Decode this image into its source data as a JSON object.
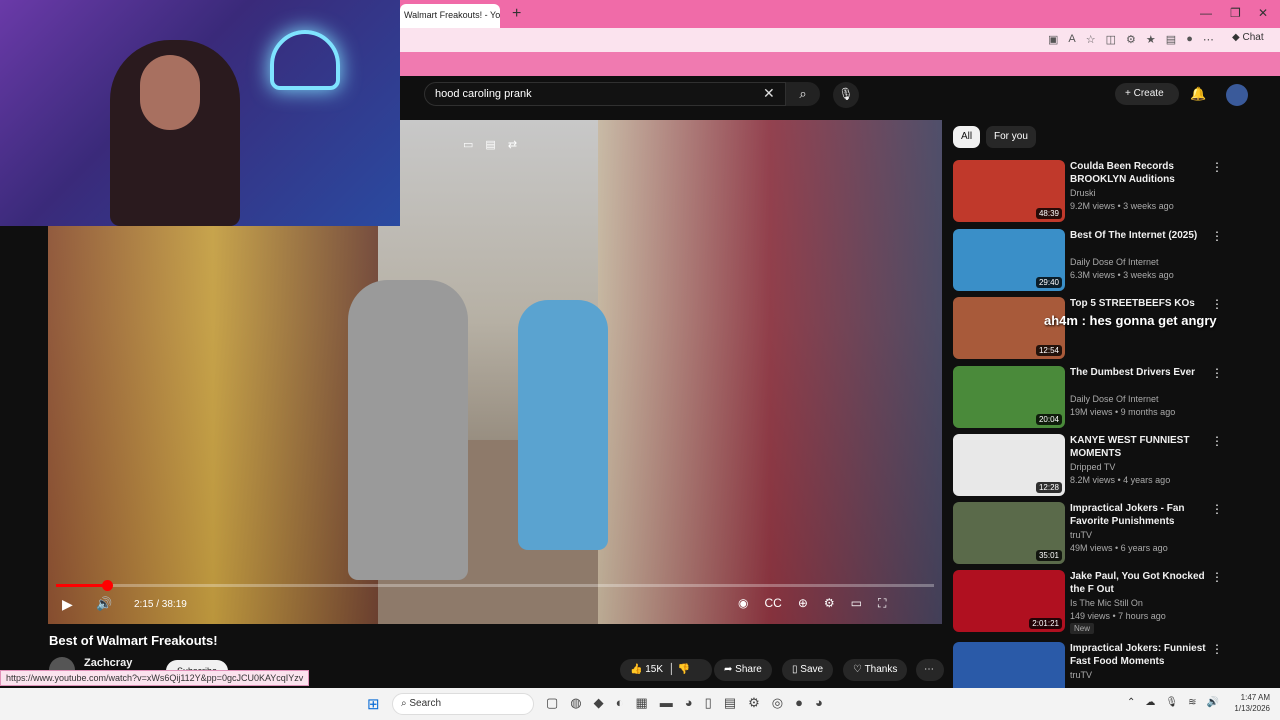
{
  "browser": {
    "tab_title": "Walmart Freakouts! - YouTube",
    "new_tab": "+",
    "chat_label": "Chat",
    "status_url": "https://www.youtube.com/watch?v=xWs6Qij112Y&pp=0gcJCU0KAYcqIYzv"
  },
  "header": {
    "search_value": "hood caroling prank",
    "create_label": "Create"
  },
  "player": {
    "progress_fraction": 0.0583,
    "timecode": "2:15 / 38:19"
  },
  "video": {
    "title": "Best of Walmart Freakouts!",
    "channel": "Zachcray",
    "subscribe_label": "Subscribe",
    "likes": "15K",
    "share_label": "Share",
    "save_label": "Save",
    "thanks_label": "Thanks"
  },
  "sidebar": {
    "chips": [
      "All",
      "For you"
    ],
    "items": [
      {
        "title": "Coulda Been Records BROOKLYN Auditions hosted b...",
        "channel": "Druski",
        "meta": "9.2M views • 3 weeks ago",
        "duration": "48:39",
        "color": "#c0392b"
      },
      {
        "title": "Best Of The Internet (2025)",
        "channel": "Daily Dose Of Internet",
        "meta": "6.3M views • 3 weeks ago",
        "duration": "29:40",
        "color": "#3a8fc8"
      },
      {
        "title": "Top 5 STREETBEEFS KOs",
        "channel": "",
        "meta": "",
        "duration": "12:54",
        "color": "#a85a3a"
      },
      {
        "title": "The Dumbest Drivers Ever",
        "channel": "Daily Dose Of Internet",
        "meta": "19M views • 9 months ago",
        "duration": "20:04",
        "color": "#4a8a3a"
      },
      {
        "title": "KANYE WEST FUNNIEST MOMENTS",
        "channel": "Dripped TV",
        "meta": "8.2M views • 4 years ago",
        "duration": "12:28",
        "color": "#e8e8e8"
      },
      {
        "title": "Impractical Jokers - Fan Favorite Punishments (Mashu...",
        "channel": "truTV",
        "meta": "49M views • 6 years ago",
        "duration": "35:01",
        "color": "#5a6a4a"
      },
      {
        "title": "Jake Paul, You Got Knocked the F Out",
        "channel": "Is The Mic Still On",
        "meta": "149 views • 7 hours ago",
        "duration": "2:01:21",
        "color": "#b01020",
        "badge": "New"
      },
      {
        "title": "Impractical Jokers: Funniest Fast Food Moments (Mashup) ...",
        "channel": "truTV",
        "meta": "",
        "duration": "",
        "color": "#2a5aa8"
      }
    ]
  },
  "chat_overlay": "ah4m : hes gonna get angry",
  "taskbar": {
    "search_label": "Search",
    "time": "1:47 AM",
    "date": "1/13/2026"
  }
}
